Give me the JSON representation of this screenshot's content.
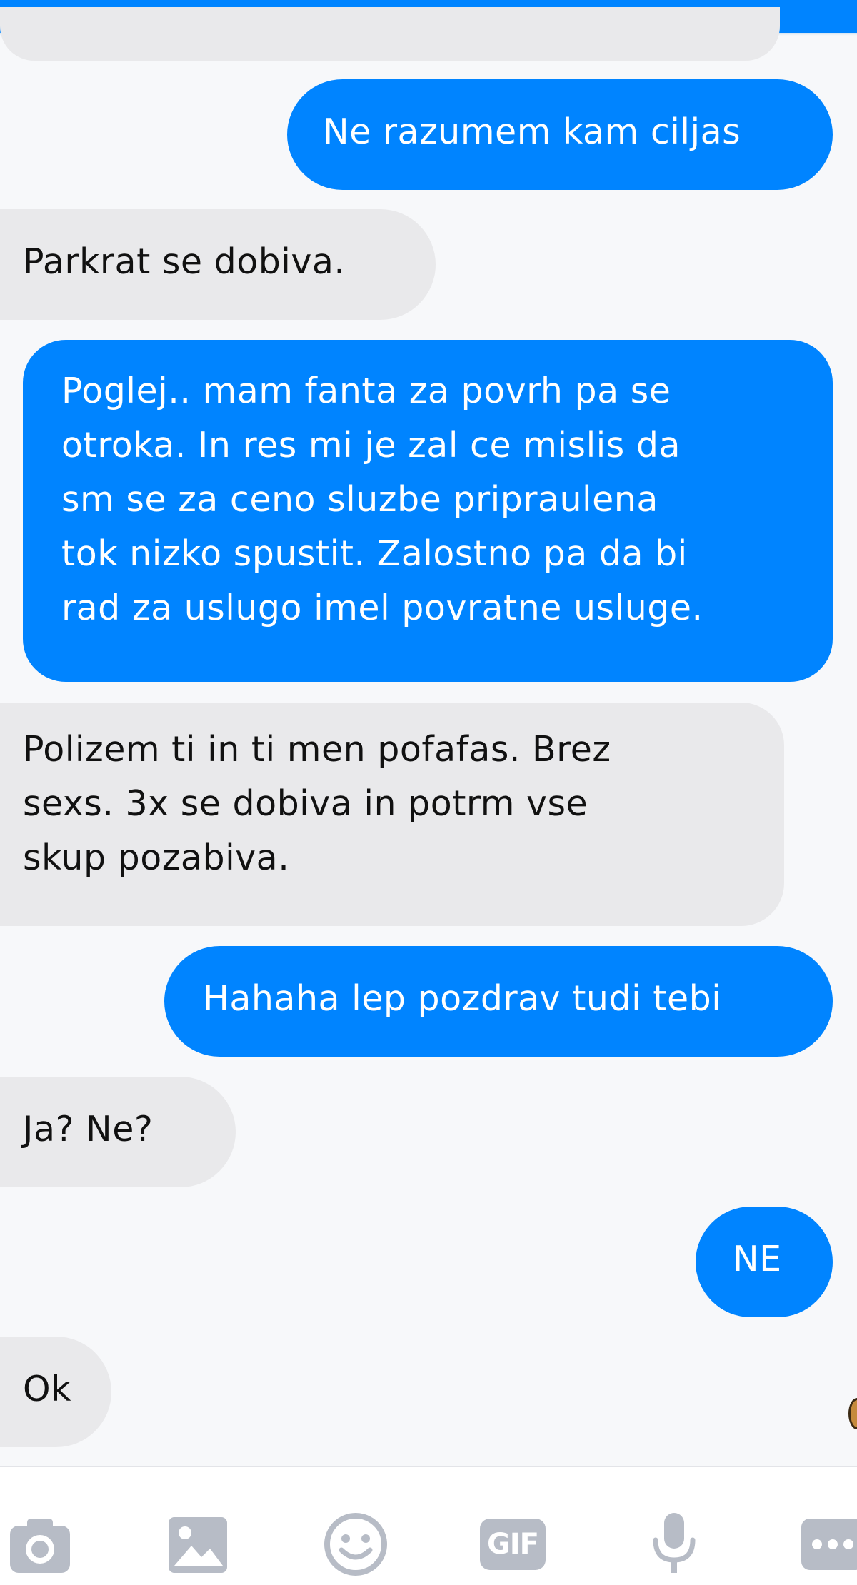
{
  "colors": {
    "accent": "#0084ff",
    "incoming_bubble": "#e9e9eb",
    "icon_gray": "#b7bcc6"
  },
  "messages": [
    {
      "direction": "outgoing",
      "lines": [
        "Ne razumem kam ciljas"
      ]
    },
    {
      "direction": "incoming",
      "lines": [
        "Parkrat se dobiva."
      ]
    },
    {
      "direction": "outgoing",
      "lines": [
        "Poglej.. mam fanta za povrh pa se",
        "otroka. In res mi je zal ce mislis da",
        "sm se za ceno sluzbe pripraulena",
        "tok  nizko spustit. Zalostno pa da bi",
        "rad za uslugo imel povratne usluge."
      ]
    },
    {
      "direction": "incoming",
      "lines": [
        "Polizem ti in ti men pofafas. Brez",
        "sexs. 3x se dobiva in potrm vse",
        "skup pozabiva."
      ]
    },
    {
      "direction": "outgoing",
      "lines": [
        "Hahaha lep pozdrav tudi tebi"
      ]
    },
    {
      "direction": "incoming",
      "lines": [
        "Ja? Ne?"
      ]
    },
    {
      "direction": "outgoing",
      "lines": [
        "NE"
      ]
    },
    {
      "direction": "incoming",
      "lines": [
        "Ok"
      ]
    }
  ],
  "composer": {
    "tools": [
      {
        "icon": "camera-icon"
      },
      {
        "icon": "gallery-icon"
      },
      {
        "icon": "emoji-icon"
      },
      {
        "icon": "gif-icon",
        "label": "GIF"
      },
      {
        "icon": "microphone-icon"
      },
      {
        "icon": "more-icon"
      }
    ]
  }
}
